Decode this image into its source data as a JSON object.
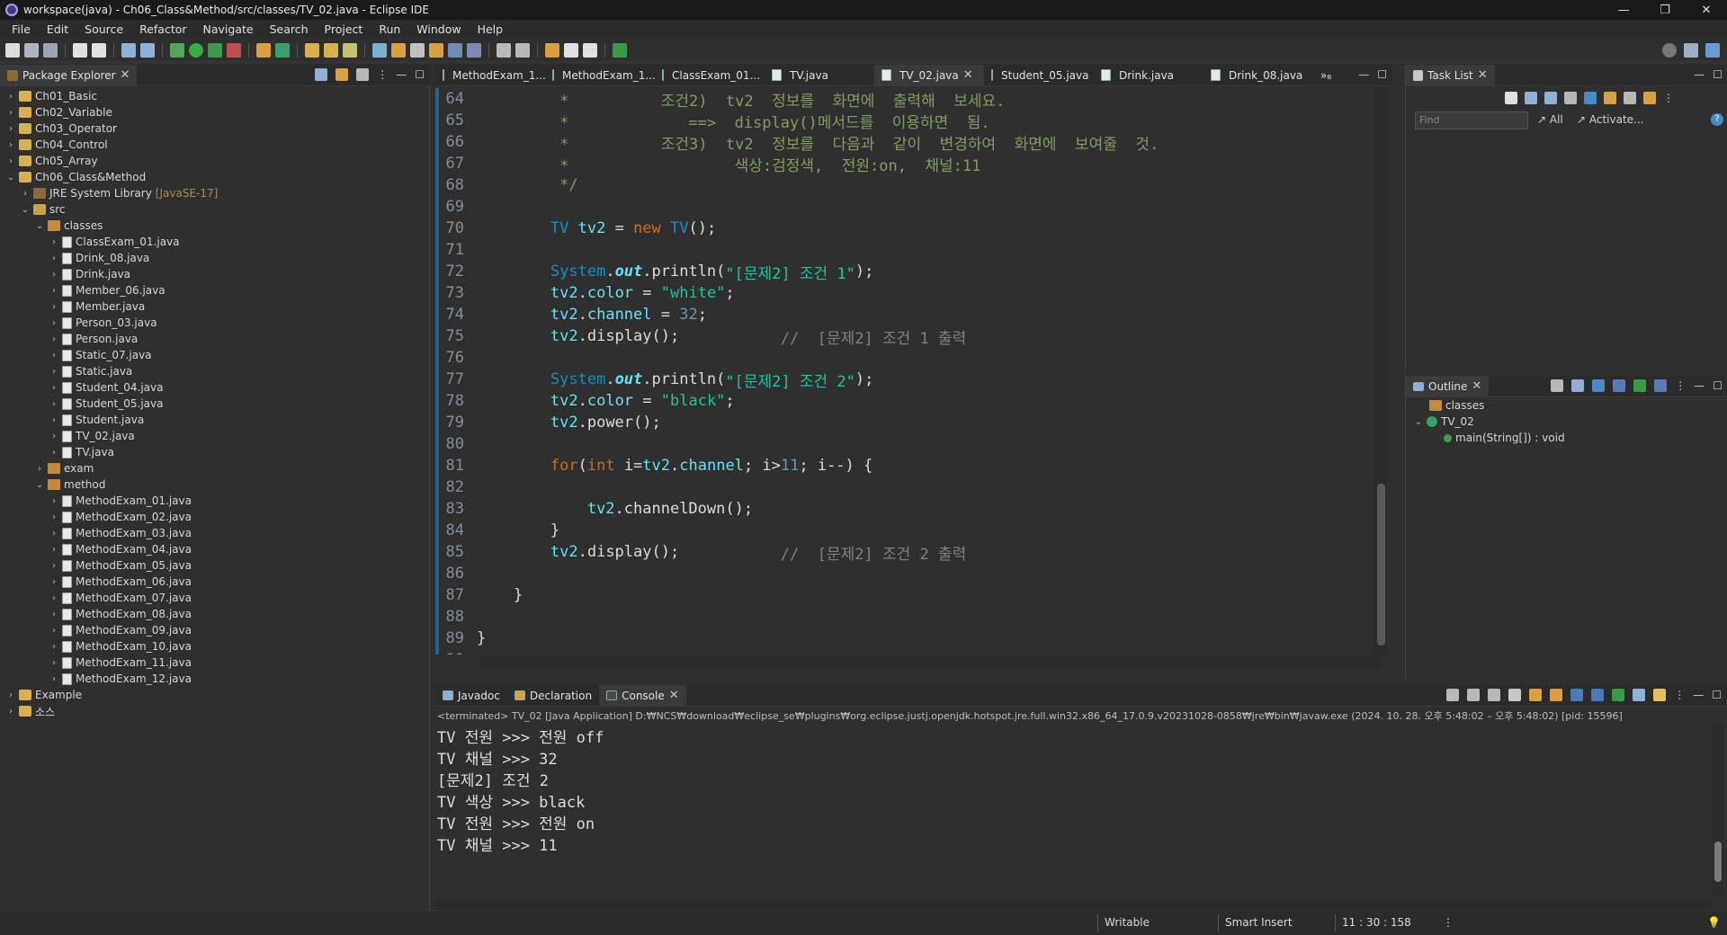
{
  "window": {
    "title": "workspace(java) - Ch06_Class&Method/src/classes/TV_02.java - Eclipse IDE",
    "minimize": "—",
    "maximize": "❐",
    "close": "✕"
  },
  "menu": [
    "File",
    "Edit",
    "Source",
    "Refactor",
    "Navigate",
    "Search",
    "Project",
    "Run",
    "Window",
    "Help"
  ],
  "package_explorer": {
    "title": "Package Explorer",
    "items": [
      {
        "label": "Ch01_Basic",
        "type": "project",
        "twisty": "›"
      },
      {
        "label": "Ch02_Variable",
        "type": "project",
        "twisty": "›"
      },
      {
        "label": "Ch03_Operator",
        "type": "project",
        "twisty": "›"
      },
      {
        "label": "Ch04_Control",
        "type": "project",
        "twisty": "›"
      },
      {
        "label": "Ch05_Array",
        "type": "project",
        "twisty": "›"
      },
      {
        "label": "Ch06_Class&Method",
        "type": "project",
        "twisty": "⌄"
      },
      {
        "label": "JRE System Library",
        "suffix": "[JavaSE-17]",
        "type": "lib",
        "twisty": "›"
      },
      {
        "label": "src",
        "type": "folder",
        "twisty": "⌄"
      },
      {
        "label": "classes",
        "type": "package",
        "twisty": "⌄"
      },
      {
        "label": "ClassExam_01.java",
        "type": "java",
        "twisty": "›"
      },
      {
        "label": "Drink_08.java",
        "type": "java",
        "twisty": "›"
      },
      {
        "label": "Drink.java",
        "type": "java",
        "twisty": "›"
      },
      {
        "label": "Member_06.java",
        "type": "java",
        "twisty": "›"
      },
      {
        "label": "Member.java",
        "type": "java",
        "twisty": "›"
      },
      {
        "label": "Person_03.java",
        "type": "java",
        "twisty": "›"
      },
      {
        "label": "Person.java",
        "type": "java",
        "twisty": "›"
      },
      {
        "label": "Static_07.java",
        "type": "java",
        "twisty": "›"
      },
      {
        "label": "Static.java",
        "type": "java",
        "twisty": "›"
      },
      {
        "label": "Student_04.java",
        "type": "java",
        "twisty": "›"
      },
      {
        "label": "Student_05.java",
        "type": "java",
        "twisty": "›"
      },
      {
        "label": "Student.java",
        "type": "java",
        "twisty": "›"
      },
      {
        "label": "TV_02.java",
        "type": "java",
        "twisty": "›"
      },
      {
        "label": "TV.java",
        "type": "java",
        "twisty": "›"
      },
      {
        "label": "exam",
        "type": "package",
        "twisty": "›"
      },
      {
        "label": "method",
        "type": "package",
        "twisty": "⌄"
      },
      {
        "label": "MethodExam_01.java",
        "type": "java",
        "twisty": "›"
      },
      {
        "label": "MethodExam_02.java",
        "type": "java",
        "twisty": "›"
      },
      {
        "label": "MethodExam_03.java",
        "type": "java",
        "twisty": "›"
      },
      {
        "label": "MethodExam_04.java",
        "type": "java",
        "twisty": "›"
      },
      {
        "label": "MethodExam_05.java",
        "type": "java",
        "twisty": "›"
      },
      {
        "label": "MethodExam_06.java",
        "type": "java",
        "twisty": "›"
      },
      {
        "label": "MethodExam_07.java",
        "type": "java",
        "twisty": "›"
      },
      {
        "label": "MethodExam_08.java",
        "type": "java",
        "twisty": "›"
      },
      {
        "label": "MethodExam_09.java",
        "type": "java",
        "twisty": "›"
      },
      {
        "label": "MethodExam_10.java",
        "type": "java",
        "twisty": "›"
      },
      {
        "label": "MethodExam_11.java",
        "type": "java",
        "twisty": "›"
      },
      {
        "label": "MethodExam_12.java",
        "type": "java",
        "twisty": "›"
      },
      {
        "label": "Example",
        "type": "project",
        "twisty": "›"
      },
      {
        "label": "소스",
        "type": "project",
        "twisty": "›"
      }
    ]
  },
  "editor": {
    "tabs": [
      {
        "label": "MethodExam_1..."
      },
      {
        "label": "MethodExam_1..."
      },
      {
        "label": "ClassExam_01..."
      },
      {
        "label": "TV.java"
      },
      {
        "label": "TV_02.java",
        "active": true
      },
      {
        "label": "Student_05.java"
      },
      {
        "label": "Drink.java"
      },
      {
        "label": "Drink_08.java"
      },
      {
        "label": "»₈"
      }
    ],
    "lines": [
      {
        "n": "64",
        "tokens": [
          [
            "cmj",
            "         *          조건2)  tv2  정보를  화면에  출력해  보세요."
          ]
        ]
      },
      {
        "n": "65",
        "tokens": [
          [
            "cmj",
            "         *             ==>  display()메서드를  이용하면  됨."
          ]
        ]
      },
      {
        "n": "66",
        "tokens": [
          [
            "cmj",
            "         *          조건3)  tv2  정보를  다음과  같이  변경하여  화면에  보여줄  것."
          ]
        ]
      },
      {
        "n": "67",
        "tokens": [
          [
            "cmj",
            "         *                  색상:검정색,  전원:on,  채널:11"
          ]
        ]
      },
      {
        "n": "68",
        "tokens": [
          [
            "cmj",
            "         */"
          ]
        ]
      },
      {
        "n": "69",
        "tokens": [
          [
            "ct",
            ""
          ]
        ]
      },
      {
        "n": "70",
        "tokens": [
          [
            "ct",
            "        "
          ],
          [
            "ty",
            "TV"
          ],
          [
            "ct",
            " "
          ],
          [
            "var",
            "tv2"
          ],
          [
            "ct",
            " = "
          ],
          [
            "kw",
            "new"
          ],
          [
            "ct",
            " "
          ],
          [
            "ty",
            "TV"
          ],
          [
            "ct",
            "();"
          ]
        ]
      },
      {
        "n": "71",
        "tokens": [
          [
            "ct",
            ""
          ]
        ]
      },
      {
        "n": "72",
        "tokens": [
          [
            "ct",
            "        "
          ],
          [
            "ty",
            "System"
          ],
          [
            "ct",
            "."
          ],
          [
            "fld",
            "out"
          ],
          [
            "ct",
            ".println("
          ],
          [
            "str",
            "\"[문제2] 조건 1\""
          ],
          [
            "ct",
            ");"
          ]
        ]
      },
      {
        "n": "73",
        "tokens": [
          [
            "ct",
            "        "
          ],
          [
            "var",
            "tv2"
          ],
          [
            "ct",
            "."
          ],
          [
            "var",
            "color"
          ],
          [
            "ct",
            " = "
          ],
          [
            "str",
            "\"white\""
          ],
          [
            "ct",
            ";"
          ]
        ]
      },
      {
        "n": "74",
        "tokens": [
          [
            "ct",
            "        "
          ],
          [
            "var",
            "tv2"
          ],
          [
            "ct",
            "."
          ],
          [
            "var",
            "channel"
          ],
          [
            "ct",
            " = "
          ],
          [
            "num",
            "32"
          ],
          [
            "ct",
            ";"
          ]
        ]
      },
      {
        "n": "75",
        "tokens": [
          [
            "ct",
            "        "
          ],
          [
            "var",
            "tv2"
          ],
          [
            "ct",
            ".display();           "
          ],
          [
            "cm",
            "//  [문제2] 조건 1 출력"
          ]
        ]
      },
      {
        "n": "76",
        "tokens": [
          [
            "ct",
            ""
          ]
        ]
      },
      {
        "n": "77",
        "tokens": [
          [
            "ct",
            "        "
          ],
          [
            "ty",
            "System"
          ],
          [
            "ct",
            "."
          ],
          [
            "fld",
            "out"
          ],
          [
            "ct",
            ".println("
          ],
          [
            "str",
            "\"[문제2] 조건 2\""
          ],
          [
            "ct",
            ");"
          ]
        ]
      },
      {
        "n": "78",
        "tokens": [
          [
            "ct",
            "        "
          ],
          [
            "var",
            "tv2"
          ],
          [
            "ct",
            "."
          ],
          [
            "var",
            "color"
          ],
          [
            "ct",
            " = "
          ],
          [
            "str",
            "\"black\""
          ],
          [
            "ct",
            ";"
          ]
        ]
      },
      {
        "n": "79",
        "tokens": [
          [
            "ct",
            "        "
          ],
          [
            "var",
            "tv2"
          ],
          [
            "ct",
            ".power();"
          ]
        ]
      },
      {
        "n": "80",
        "tokens": [
          [
            "ct",
            ""
          ]
        ]
      },
      {
        "n": "81",
        "tokens": [
          [
            "ct",
            "        "
          ],
          [
            "kw",
            "for"
          ],
          [
            "ct",
            "("
          ],
          [
            "kw",
            "int"
          ],
          [
            "ct",
            " i="
          ],
          [
            "var",
            "tv2"
          ],
          [
            "ct",
            "."
          ],
          [
            "var",
            "channel"
          ],
          [
            "ct",
            "; i>"
          ],
          [
            "num",
            "11"
          ],
          [
            "ct",
            "; i--) {"
          ]
        ]
      },
      {
        "n": "82",
        "tokens": [
          [
            "ct",
            ""
          ]
        ]
      },
      {
        "n": "83",
        "tokens": [
          [
            "ct",
            "            "
          ],
          [
            "var",
            "tv2"
          ],
          [
            "ct",
            ".channelDown();"
          ]
        ]
      },
      {
        "n": "84",
        "tokens": [
          [
            "ct",
            "        }"
          ]
        ]
      },
      {
        "n": "85",
        "tokens": [
          [
            "ct",
            "        "
          ],
          [
            "var",
            "tv2"
          ],
          [
            "ct",
            ".display();           "
          ],
          [
            "cm",
            "//  [문제2] 조건 2 출력"
          ]
        ]
      },
      {
        "n": "86",
        "tokens": [
          [
            "ct",
            ""
          ]
        ]
      },
      {
        "n": "87",
        "tokens": [
          [
            "ct",
            "    }"
          ]
        ]
      },
      {
        "n": "88",
        "tokens": [
          [
            "ct",
            ""
          ]
        ]
      },
      {
        "n": "89",
        "tokens": [
          [
            "ct",
            "}"
          ]
        ]
      },
      {
        "n": "90",
        "tokens": [
          [
            "ct",
            ""
          ]
        ]
      }
    ]
  },
  "console": {
    "tabs": [
      {
        "label": "Javadoc",
        "icon": "javadoc-icon"
      },
      {
        "label": "Declaration",
        "icon": "declaration-icon"
      },
      {
        "label": "Console",
        "icon": "console-icon",
        "active": true
      }
    ],
    "status": "<terminated> TV_02 [Java Application] D:₩NCS₩download₩eclipse_se₩plugins₩org.eclipse.justj.openjdk.hotspot.jre.full.win32.x86_64_17.0.9.v20231028-0858₩jre₩bin₩javaw.exe  (2024. 10. 28. 오후 5:48:02 – 오후 5:48:02) [pid: 15596]",
    "lines": [
      "TV 전원 >>> 전원 off",
      "TV 채널 >>> 32",
      "[문제2] 조건 2",
      "TV 색상 >>> black",
      "TV 전원 >>> 전원 on",
      "TV 채널 >>> 11"
    ]
  },
  "tasklist": {
    "title": "Task List",
    "find_placeholder": "Find",
    "all": "All",
    "activate": "Activate..."
  },
  "outline": {
    "title": "Outline",
    "items": [
      {
        "label": "classes",
        "kind": "package"
      },
      {
        "label": "TV_02",
        "kind": "class"
      },
      {
        "label": "main(String[]) : void",
        "kind": "method"
      }
    ]
  },
  "status": {
    "writable": "Writable",
    "insert": "Smart Insert",
    "position": "11 : 30 : 158"
  },
  "colors": {
    "background": "#2f2f2f",
    "keyword": "#cc6c1d",
    "type": "#1290c3",
    "string": "#17c6a3",
    "field": "#66e1f8"
  }
}
